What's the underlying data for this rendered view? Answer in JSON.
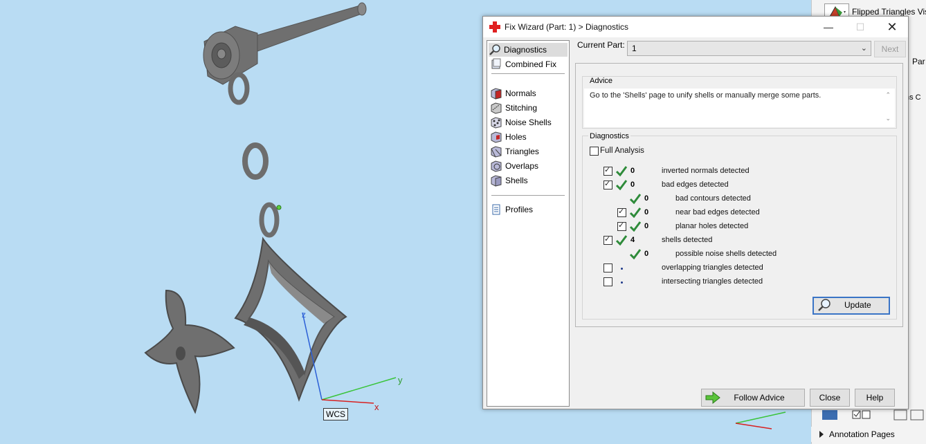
{
  "dialog": {
    "title": "Fix Wizard (Part: 1) > Diagnostics",
    "nav": [
      {
        "label": "Diagnostics",
        "icon": "magnifier-icon"
      },
      {
        "label": "Combined Fix",
        "icon": "combined-fix-icon"
      },
      {
        "label": "Normals",
        "icon": "normals-icon"
      },
      {
        "label": "Stitching",
        "icon": "stitching-icon"
      },
      {
        "label": "Noise Shells",
        "icon": "noise-shells-icon"
      },
      {
        "label": "Holes",
        "icon": "holes-icon"
      },
      {
        "label": "Triangles",
        "icon": "triangles-icon"
      },
      {
        "label": "Overlaps",
        "icon": "overlaps-icon"
      },
      {
        "label": "Shells",
        "icon": "shells-icon"
      },
      {
        "label": "Profiles",
        "icon": "profiles-icon"
      }
    ],
    "current_part_label": "Current Part:",
    "current_part_value": "1",
    "next_label": "Next",
    "advice_title": "Advice",
    "advice_text": "Go to the 'Shells' page to unify shells or manually merge some parts.",
    "diagnostics_title": "Diagnostics",
    "full_analysis_label": "Full Analysis",
    "rows": [
      {
        "count": "0",
        "label": "inverted normals detected"
      },
      {
        "count": "0",
        "label": "bad edges detected"
      },
      {
        "count": "0",
        "label": "bad contours detected"
      },
      {
        "count": "0",
        "label": "near bad edges detected"
      },
      {
        "count": "0",
        "label": "planar holes detected"
      },
      {
        "count": "4",
        "label": "shells detected"
      },
      {
        "count": "0",
        "label": "possible noise shells detected"
      },
      {
        "count": "",
        "label": "overlapping triangles detected"
      },
      {
        "count": "",
        "label": "intersecting triangles detected"
      }
    ],
    "update_label": "Update",
    "follow_advice_label": "Follow Advice",
    "close_label": "Close",
    "help_label": "Help"
  },
  "viewport": {
    "axis_x": "x",
    "axis_y": "y",
    "axis_z": "z",
    "wcs_label": "WCS"
  },
  "side_panel": {
    "flipped_label": "Flipped Triangles Visi",
    "par_label": "Par",
    "ns_label": "ns  C",
    "annotation_label": "Annotation Pages"
  },
  "colors": {
    "viewport_bg": "#b9dcf3",
    "check_green": "#2e8b3a",
    "focus_blue": "#3a74c6",
    "title_icon_red": "#e02020"
  }
}
